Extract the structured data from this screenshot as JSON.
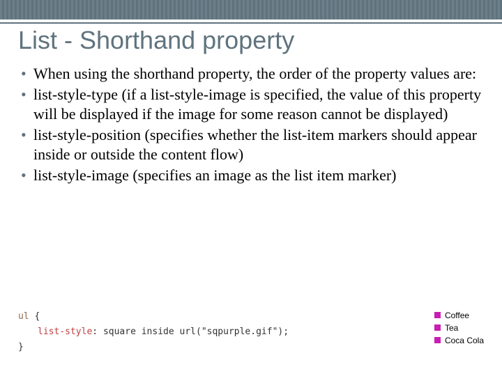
{
  "slide": {
    "title": "List - Shorthand property",
    "bullets": [
      "When using the shorthand property, the order of the property values are:",
      "list-style-type (if a list-style-image is specified, the value of this property will be displayed if the image for some reason cannot be displayed)",
      "list-style-position (specifies whether the list-item markers should appear inside or outside the content flow)",
      "list-style-image (specifies an image as the list item marker)"
    ]
  },
  "code": {
    "selector": "ul",
    "brace_open": "{",
    "property": "list-style",
    "colon": ":",
    "value": "square inside url(\"sqpurple.gif\")",
    "semicolon": ";",
    "brace_close": "}"
  },
  "example": {
    "items": [
      "Coffee",
      "Tea",
      "Coca Cola"
    ]
  }
}
